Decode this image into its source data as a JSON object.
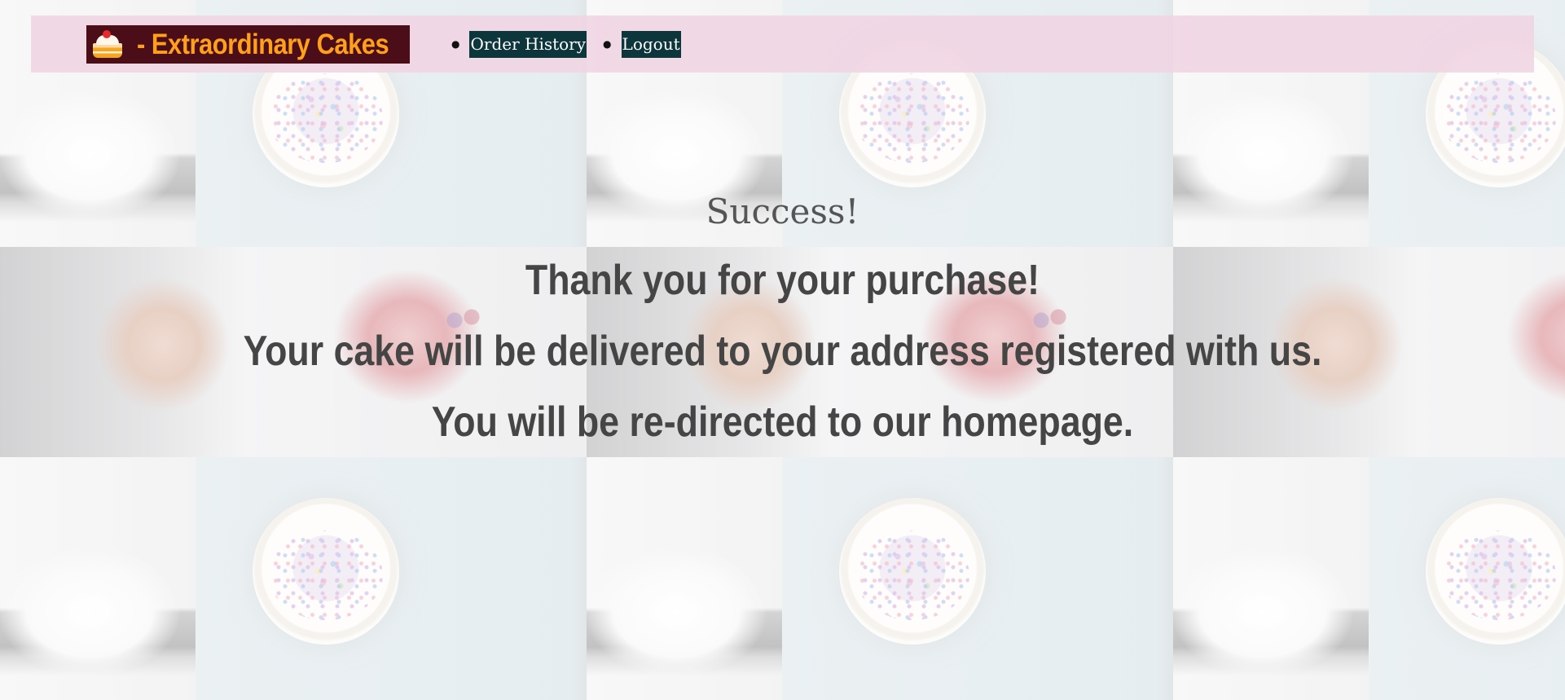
{
  "header": {
    "logo_text": "- Extraordinary Cakes",
    "nav": [
      {
        "label": "Order History"
      },
      {
        "label": "Logout"
      }
    ]
  },
  "main": {
    "title": "Success!",
    "messages": [
      "Thank you for your purchase!",
      "Your cake will be delivered to your address registered with us.",
      "You will be re-directed to our homepage."
    ]
  },
  "colors": {
    "navbar_bg": "#f0d4e2",
    "logo_bg": "#4b0d18",
    "logo_text": "#ffa01b",
    "nav_link_bg": "#0d353c",
    "nav_link_text": "#ffffff",
    "title_text": "#555555",
    "message_text": "#454545"
  },
  "icons": {
    "logo": "cake-slice-icon"
  }
}
